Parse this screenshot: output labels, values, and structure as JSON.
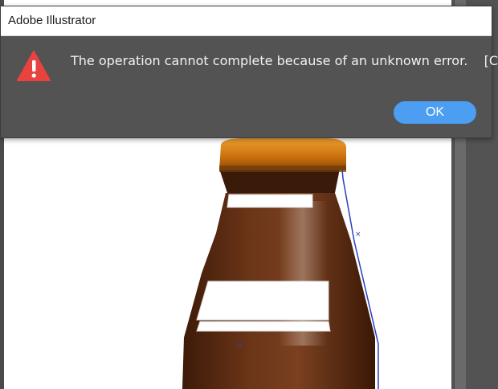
{
  "dialog": {
    "title": "Adobe Illustrator",
    "message": "The operation cannot complete because of an unknown error.    [CANT]",
    "icon": "warning-icon",
    "ok_label": "OK"
  },
  "colors": {
    "dialog_bg": "#535353",
    "warning_red": "#e8433f",
    "ok_blue": "#4b9ef1",
    "bottle_brown": "#5a2c12",
    "cap_orange": "#d67a12"
  }
}
